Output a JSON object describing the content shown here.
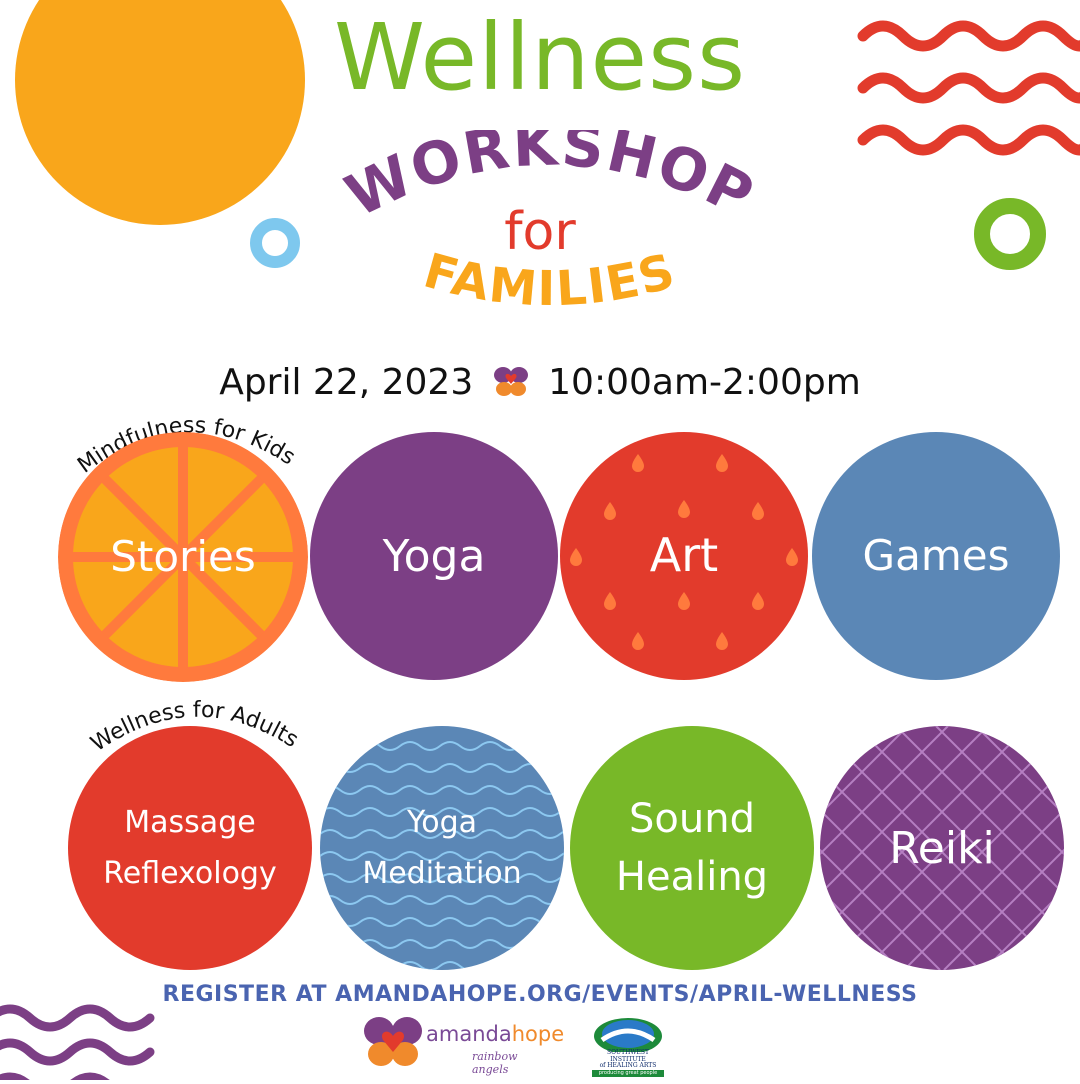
{
  "colors": {
    "green": "#78b828",
    "purple": "#7c3f85",
    "orange": "#f9a61b",
    "red": "#e23b2c",
    "blue": "#5b87b6",
    "light_blue": "#7ec8ee",
    "register_blue": "#4a64b0"
  },
  "title": {
    "line1": "Wellness",
    "line2": "WORKSHOP",
    "line3": "for",
    "line4": "FAMILIES"
  },
  "event": {
    "date": "April 22, 2023",
    "time": "10:00am-2:00pm",
    "separator_icon": "butterfly-icon"
  },
  "kids": {
    "heading": "Mindfulness for Kids",
    "items": [
      {
        "label": "Stories",
        "color": "#f9a61b"
      },
      {
        "label": "Yoga",
        "color": "#7c3f85"
      },
      {
        "label": "Art",
        "color": "#e23b2c"
      },
      {
        "label": "Games",
        "color": "#5b87b6"
      }
    ]
  },
  "adults": {
    "heading": "Wellness for Adults",
    "items": [
      {
        "line1": "Massage",
        "line2": "Reflexology",
        "color": "#e23b2c"
      },
      {
        "line1": "Yoga",
        "line2": "Meditation",
        "color": "#5b87b6"
      },
      {
        "line1": "Sound",
        "line2": "Healing",
        "color": "#78b828"
      },
      {
        "line1": "Reiki",
        "line2": "",
        "color": "#7c3f85"
      }
    ]
  },
  "register": {
    "text": "REGISTER AT AMANDAHOPE.ORG/EVENTS/APRIL-WELLNESS"
  },
  "logos": {
    "amandahope": {
      "word1": "amanda",
      "word2": "hope",
      "tagline": "rainbow angels",
      "icon": "butterfly-heart-icon"
    },
    "swiha": {
      "line1": "SOUTHWEST INSTITUTE",
      "line2": "of HEALING ARTS",
      "tagline": "producing great people worldwide",
      "icon": "globe-hands-icon"
    }
  }
}
